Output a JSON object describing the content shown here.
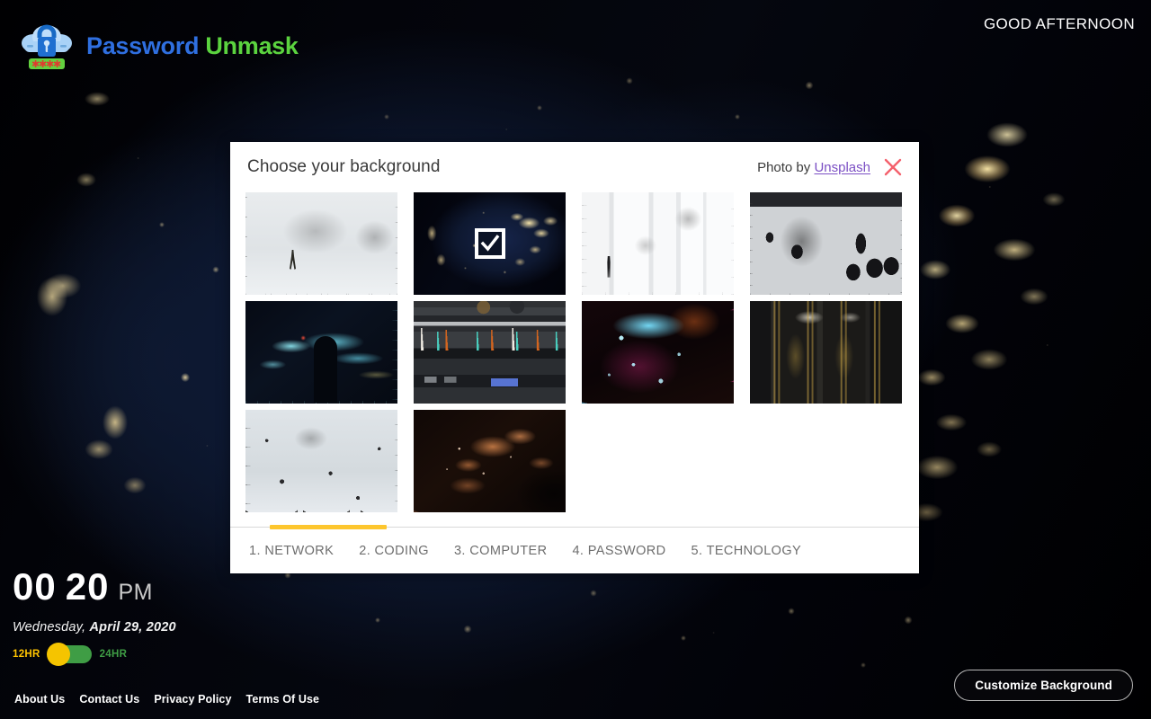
{
  "brand": {
    "logo_icon": "cloud-lock-password-icon",
    "name_part1": "Password",
    "name_part2": "Unmask",
    "color_part1": "#2f6fe0",
    "color_part2": "#5bd33f"
  },
  "header": {
    "greeting": "GOOD AFTERNOON"
  },
  "clock": {
    "hours": "00",
    "minutes": "20",
    "meridiem": "PM",
    "day_of_week": "Wednesday,",
    "date": "April 29, 2020",
    "format_toggle": {
      "left_label": "12HR",
      "right_label": "24HR",
      "active": "12HR",
      "left_color": "#ffc400",
      "right_color": "#3f9d45",
      "track_color": "#3f9d45",
      "knob_color": "#f5c400"
    }
  },
  "footer": {
    "links": [
      {
        "label": "About Us"
      },
      {
        "label": "Contact Us"
      },
      {
        "label": "Privacy Policy"
      },
      {
        "label": "Terms Of Use"
      }
    ],
    "customize_button": "Customize Background"
  },
  "dialog": {
    "title": "Choose your background",
    "credit_prefix": "Photo by",
    "credit_link": "Unsplash",
    "credit_link_color": "#7b4fc4",
    "close_icon": "close-x-icon",
    "close_icon_color": "#f4606c",
    "selected_index": 1,
    "selected_check_icon": "checkmark-icon",
    "thumbnails": [
      {
        "name": "snow-wires-figure",
        "art": "art-snow-lines",
        "selected": false
      },
      {
        "name": "usa-city-lights-at-night",
        "art": "art-night-usa",
        "selected": true
      },
      {
        "name": "white-hall-string-art",
        "art": "art-white-hall",
        "selected": false
      },
      {
        "name": "gallery-string-installation",
        "art": "art-gallery-dark",
        "selected": false
      },
      {
        "name": "cyan-light-streaks-silhouette",
        "art": "art-cyan-streaks",
        "selected": false
      },
      {
        "name": "network-rack-patch-cables",
        "art": "art-rack",
        "selected": false
      },
      {
        "name": "fiber-optic-strands",
        "art": "art-fiber",
        "selected": false
      },
      {
        "name": "server-room-amber-cables",
        "art": "art-server-amber",
        "selected": false
      },
      {
        "name": "gray-network-web",
        "art": "art-web-gray",
        "selected": false
      },
      {
        "name": "aerial-night-city-copper",
        "art": "art-aerial-copper",
        "selected": false
      }
    ],
    "tabs": [
      {
        "label": "1. NETWORK",
        "active": true
      },
      {
        "label": "2. CODING",
        "active": false
      },
      {
        "label": "3. COMPUTER",
        "active": false
      },
      {
        "label": "4. PASSWORD",
        "active": false
      },
      {
        "label": "5. TECHNOLOGY",
        "active": false
      }
    ],
    "tab_indicator_color": "#fdc62e"
  }
}
